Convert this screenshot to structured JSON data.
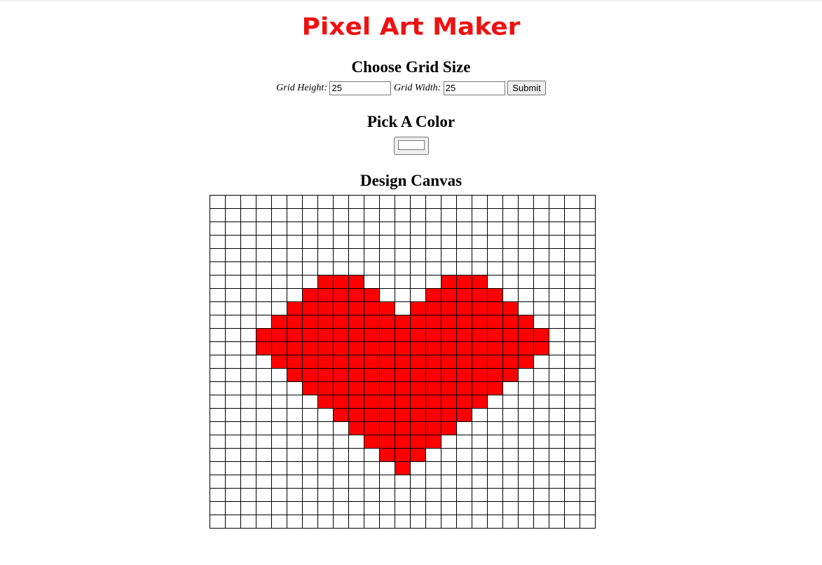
{
  "title": "Pixel Art Maker",
  "sections": {
    "grid_size_heading": "Choose Grid Size",
    "color_heading": "Pick A Color",
    "canvas_heading": "Design Canvas"
  },
  "grid_form": {
    "height_label": "Grid Height:",
    "height_value": "25",
    "width_label": "Grid Width:",
    "width_value": "25",
    "submit_label": "Submit"
  },
  "color_picker": {
    "value": "#ffffff"
  },
  "canvas": {
    "rows": 25,
    "cols": 25,
    "fill_color": "#ff0000",
    "empty_color": "#ffffff",
    "filled_cells": [
      [
        6,
        [
          7,
          8,
          9,
          15,
          16,
          17
        ]
      ],
      [
        7,
        [
          6,
          7,
          8,
          9,
          10,
          14,
          15,
          16,
          17,
          18
        ]
      ],
      [
        8,
        [
          5,
          6,
          7,
          8,
          9,
          10,
          11,
          13,
          14,
          15,
          16,
          17,
          18,
          19
        ]
      ],
      [
        9,
        [
          4,
          5,
          6,
          7,
          8,
          9,
          10,
          11,
          12,
          13,
          14,
          15,
          16,
          17,
          18,
          19,
          20
        ]
      ],
      [
        10,
        [
          3,
          4,
          5,
          6,
          7,
          8,
          9,
          10,
          11,
          12,
          13,
          14,
          15,
          16,
          17,
          18,
          19,
          20,
          21
        ]
      ],
      [
        11,
        [
          3,
          4,
          5,
          6,
          7,
          8,
          9,
          10,
          11,
          12,
          13,
          14,
          15,
          16,
          17,
          18,
          19,
          20,
          21
        ]
      ],
      [
        12,
        [
          4,
          5,
          6,
          7,
          8,
          9,
          10,
          11,
          12,
          13,
          14,
          15,
          16,
          17,
          18,
          19,
          20
        ]
      ],
      [
        13,
        [
          5,
          6,
          7,
          8,
          9,
          10,
          11,
          12,
          13,
          14,
          15,
          16,
          17,
          18,
          19
        ]
      ],
      [
        14,
        [
          6,
          7,
          8,
          9,
          10,
          11,
          12,
          13,
          14,
          15,
          16,
          17,
          18
        ]
      ],
      [
        15,
        [
          7,
          8,
          9,
          10,
          11,
          12,
          13,
          14,
          15,
          16,
          17
        ]
      ],
      [
        16,
        [
          8,
          9,
          10,
          11,
          12,
          13,
          14,
          15,
          16
        ]
      ],
      [
        17,
        [
          9,
          10,
          11,
          12,
          13,
          14,
          15
        ]
      ],
      [
        18,
        [
          10,
          11,
          12,
          13,
          14
        ]
      ],
      [
        19,
        [
          11,
          12,
          13
        ]
      ],
      [
        20,
        [
          12
        ]
      ]
    ]
  }
}
